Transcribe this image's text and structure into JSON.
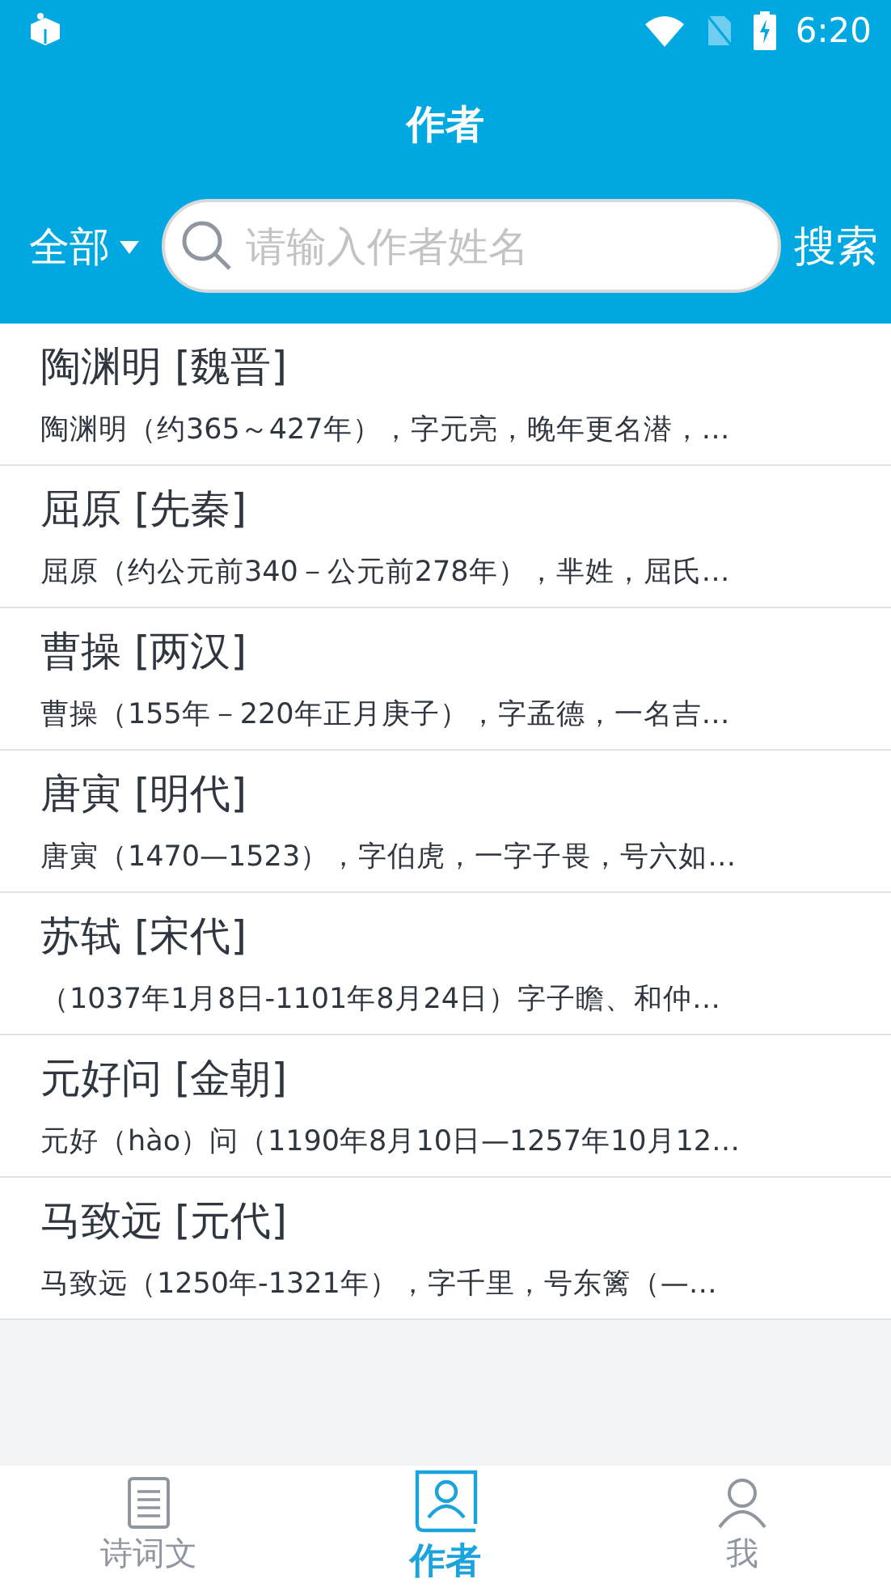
{
  "status_bar": {
    "time": "6:20"
  },
  "header": {
    "title": "作者"
  },
  "filter": {
    "label": "全部"
  },
  "search": {
    "placeholder": "请输入作者姓名",
    "button": "搜索"
  },
  "authors": [
    {
      "name": "陶渊明 [魏晋]",
      "summary": "陶渊明（约365～427年），字元亮，晚年更名潜，…"
    },
    {
      "name": "屈原 [先秦]",
      "summary": "屈原（约公元前340－公元前278年），芈姓，屈氏…"
    },
    {
      "name": "曹操 [两汉]",
      "summary": "曹操（155年－220年正月庚子），字孟德，一名吉…"
    },
    {
      "name": "唐寅 [明代]",
      "summary": "唐寅（1470—1523），字伯虎，一字子畏，号六如…"
    },
    {
      "name": "苏轼 [宋代]",
      "summary": "（1037年1月8日-1101年8月24日）字子瞻、和仲…"
    },
    {
      "name": "元好问 [金朝]",
      "summary": "元好（hào）问（1190年8月10日—1257年10月12…"
    },
    {
      "name": "马致远 [元代]",
      "summary": "马致远（1250年-1321年），字千里，号东篱（—…"
    }
  ],
  "tabs": [
    {
      "label": "诗词文",
      "kind": "document",
      "selected": false
    },
    {
      "label": "作者",
      "kind": "person-card",
      "selected": true
    },
    {
      "label": "我",
      "kind": "person",
      "selected": false
    }
  ]
}
